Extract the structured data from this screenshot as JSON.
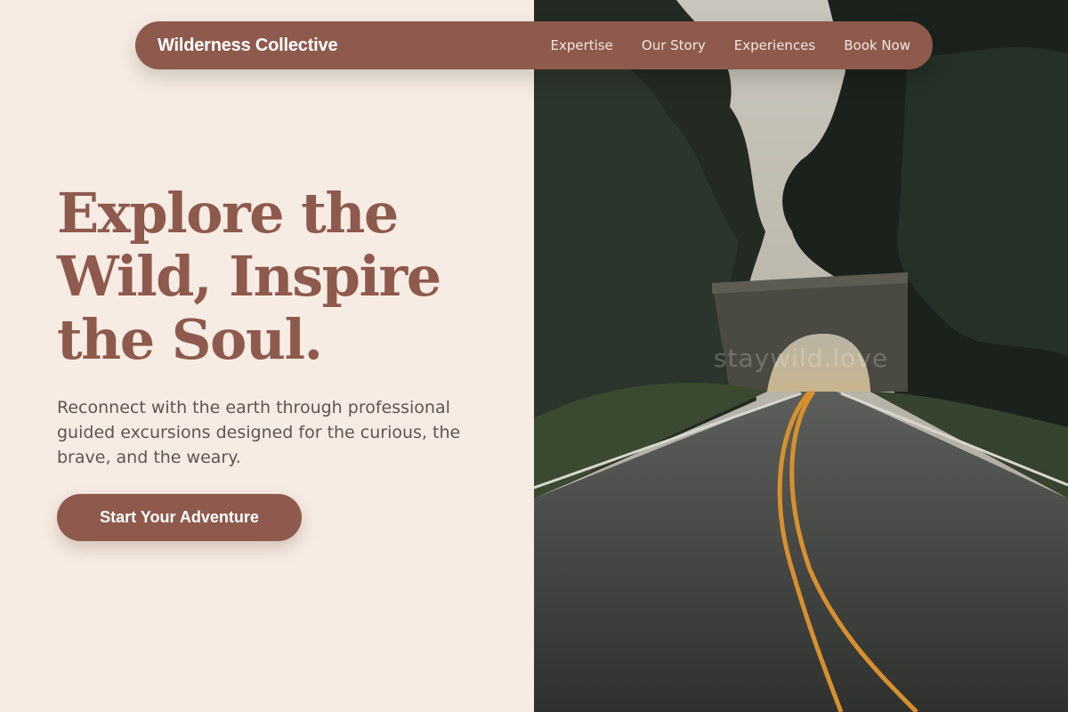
{
  "nav": {
    "brand": "Wilderness Collective",
    "links": [
      "Expertise",
      "Our Story",
      "Experiences",
      "Book Now"
    ]
  },
  "hero": {
    "headline": "Explore the Wild, Inspire the Soul.",
    "subtext": "Reconnect with the earth through professional guided excursions designed for the curious, the brave, and the weary.",
    "cta_label": "Start Your Adventure"
  },
  "image": {
    "watermark": "staywild.love",
    "icon": "forest-road-tunnel-photo"
  },
  "colors": {
    "accent": "#8e5a4d",
    "background": "#f6ece3",
    "body_text": "#5e5551",
    "nav_text": "#f4e7de"
  }
}
